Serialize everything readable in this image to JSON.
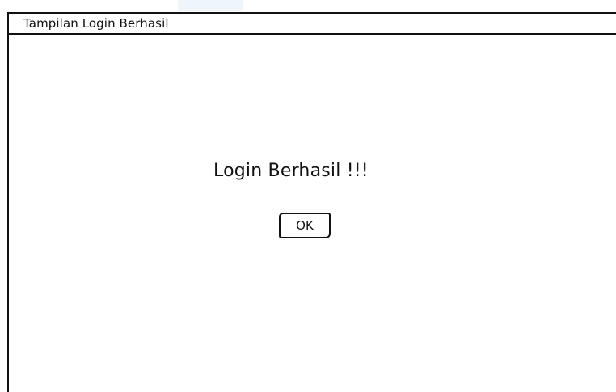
{
  "window": {
    "title": "Tampilan Login Berhasil"
  },
  "dialog": {
    "message": "Login Berhasil !!!",
    "ok_label": "OK"
  }
}
